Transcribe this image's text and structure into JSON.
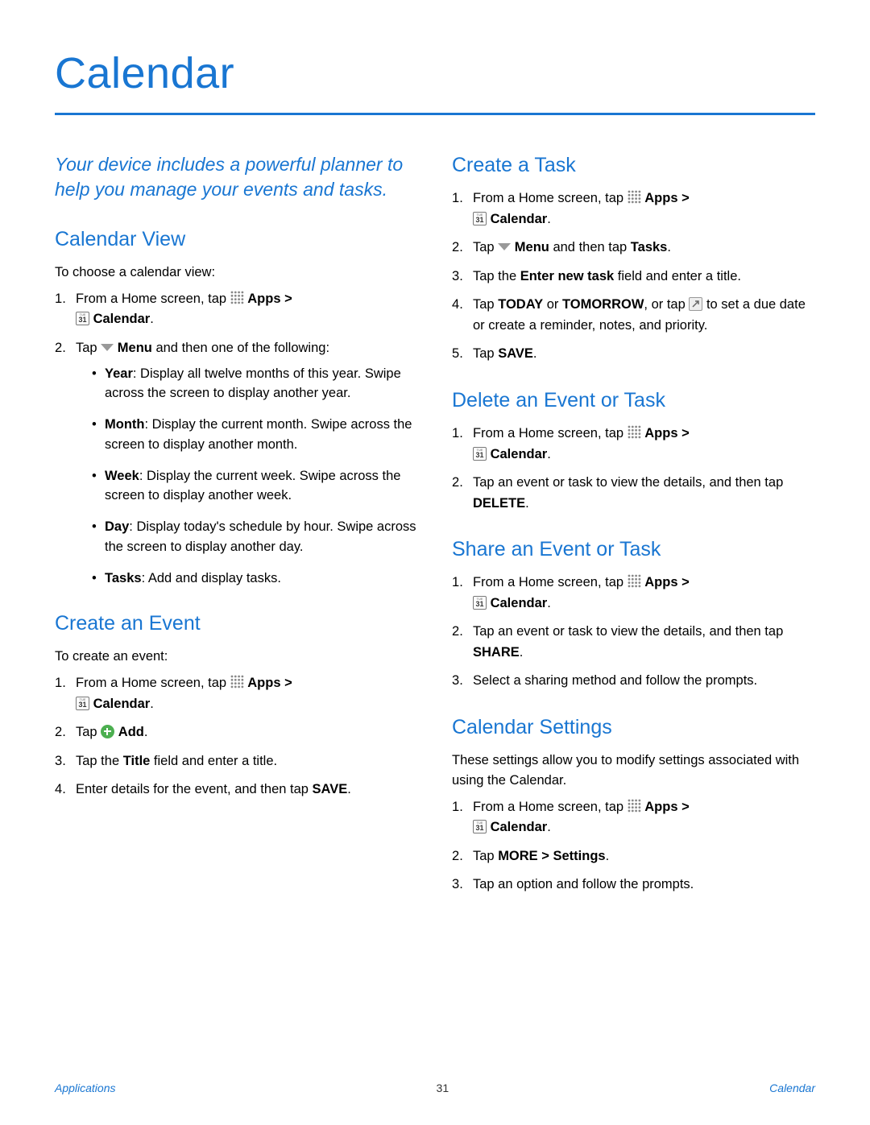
{
  "title": "Calendar",
  "intro": "Your device includes a powerful planner to help you manage your events and tasks.",
  "labels": {
    "apps": "Apps",
    "calendar": "Calendar",
    "menu": "Menu",
    "add": "Add",
    "save": "SAVE",
    "delete": "DELETE",
    "share": "SHARE",
    "today": "TODAY",
    "tomorrow": "TOMORROW",
    "more": "MORE",
    "settings": "Settings",
    "tasks_word": "Tasks",
    "title_word": "Title",
    "enter_new_task": "Enter new task"
  },
  "sections": {
    "calendar_view": {
      "heading": "Calendar View",
      "lead": "To choose a calendar view:",
      "step1_a": "From a Home screen, tap ",
      "step1_b": " > ",
      "step1_c": ".",
      "step2_a": "Tap ",
      "step2_b": " and then one of the following:",
      "bullets": {
        "year_label": "Year",
        "year_text": ": Display all twelve months of this year. Swipe across the screen to display another year.",
        "month_label": "Month",
        "month_text": ": Display the current month. Swipe across the screen to display another month.",
        "week_label": "Week",
        "week_text": ": Display the current week. Swipe across the screen to display another week.",
        "day_label": "Day",
        "day_text": ": Display today's schedule by hour. Swipe across the screen to display another day.",
        "tasks_label": "Tasks",
        "tasks_text": ": Add and display tasks."
      }
    },
    "create_event": {
      "heading": "Create an Event",
      "lead": "To create an event:",
      "step1_a": "From a Home screen, tap ",
      "step2_a": "Tap ",
      "step2_b": ".",
      "step3_a": "Tap the ",
      "step3_b": " field and enter a title.",
      "step4": "Enter details for the event, and then tap "
    },
    "create_task": {
      "heading": "Create a Task",
      "step1_a": "From a Home screen, tap ",
      "step2_a": "Tap ",
      "step2_b": " and then tap ",
      "step2_c": ".",
      "step3_a": "Tap the ",
      "step3_b": " field and enter a title.",
      "step4_a": "Tap ",
      "step4_b": " or ",
      "step4_c": ", or tap ",
      "step4_d": " to set a due date or create a reminder, notes, and priority.",
      "step5_a": "Tap ",
      "step5_b": "."
    },
    "delete": {
      "heading": "Delete an Event or Task",
      "step1_a": "From a Home screen, tap ",
      "step2_a": "Tap an event or task to view the details, and then tap ",
      "step2_b": "."
    },
    "share": {
      "heading": "Share an Event or Task",
      "step1_a": "From a Home screen, tap ",
      "step2_a": "Tap an event or task to view the details, and then tap ",
      "step2_b": ".",
      "step3": "Select a sharing method and follow the prompts."
    },
    "settings": {
      "heading": "Calendar Settings",
      "lead": "These settings allow you to modify settings associated with using the Calendar.",
      "step1_a": "From a Home screen, tap ",
      "step2_a": "Tap ",
      "step2_b": " > ",
      "step2_c": ".",
      "step3": "Tap an option and follow the prompts."
    }
  },
  "footer": {
    "left": "Applications",
    "center": "31",
    "right": "Calendar"
  }
}
